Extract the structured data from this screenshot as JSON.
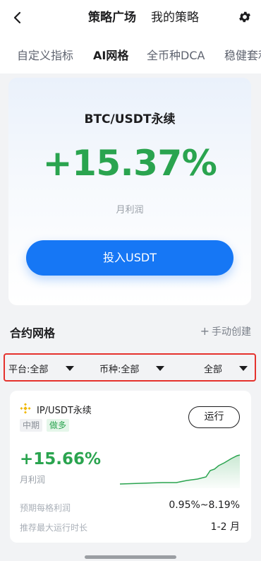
{
  "header": {
    "tabs": [
      {
        "label": "策略广场",
        "active": true
      },
      {
        "label": "我的策略",
        "active": false
      }
    ],
    "back_icon": "chevron-left-icon",
    "settings_icon": "gear-icon"
  },
  "subtabs": [
    {
      "label": "自定义指标",
      "active": false
    },
    {
      "label": "AI网格",
      "active": true
    },
    {
      "label": "全币种DCA",
      "active": false
    },
    {
      "label": "稳健套利",
      "active": false
    }
  ],
  "hero": {
    "pair": "BTC/USDT永续",
    "rate": "+15.37%",
    "rate_label": "月利润",
    "button_label": "投入USDT"
  },
  "section": {
    "title": "合约网格",
    "create_label": "手动创建",
    "create_icon": "plus-icon"
  },
  "filters": [
    {
      "label": "平台:全部"
    },
    {
      "label": "币种:全部"
    },
    {
      "label": "全部"
    }
  ],
  "card": {
    "pair": "IP/USDT永续",
    "coin_icon": "binance-logo-icon",
    "term_tag": "中期",
    "direction_tag": "做多",
    "run_label": "运行",
    "rate": "+15.66%",
    "rate_label": "月利润",
    "rows": [
      {
        "label": "预期每格利润",
        "value": "0.95%~8.19%"
      },
      {
        "label": "推荐最大运行时长",
        "value": "1-2 月"
      }
    ]
  },
  "colors": {
    "profit_green": "#2aa44f",
    "primary_blue": "#1677f5",
    "highlight_red": "#e5322d",
    "binance_yellow": "#f0b90b"
  }
}
